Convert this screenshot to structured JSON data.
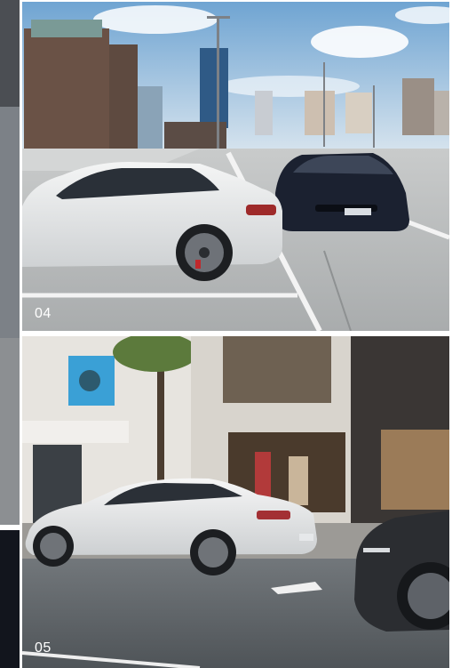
{
  "gallery": {
    "photo_04": {
      "number": "04"
    },
    "photo_05": {
      "number": "05"
    }
  },
  "colors": {
    "sky": "#8fb9dc",
    "parking_deck": "#b9bcbd",
    "white_car": "#e9eaea",
    "dark_car": "#1b2130",
    "building": "#e2dfda",
    "street": "#5f6468",
    "number_text": "#ffffff"
  }
}
